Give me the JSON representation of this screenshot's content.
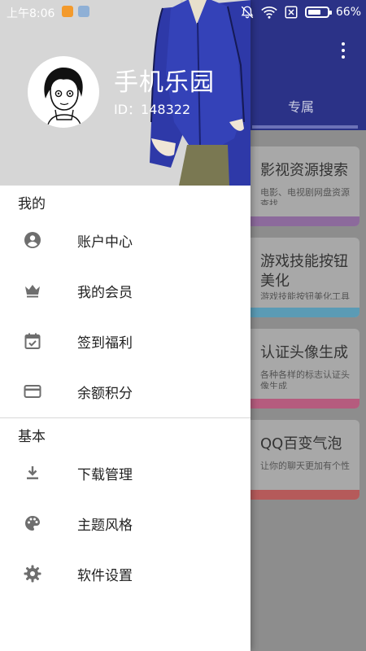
{
  "status_bar": {
    "time": "上午8:06",
    "battery": "66%",
    "battery_level": 0.66
  },
  "background": {
    "tab_label": "专属",
    "cards": [
      {
        "title": "影视资源搜索",
        "desc": "电影、电视剧网盘资源查找",
        "color": "#8c6a9c"
      },
      {
        "title": "游戏技能按钮美化",
        "desc": "游戏技能按钮美化工具",
        "color": "#5b9bb5"
      },
      {
        "title": "认证头像生成",
        "desc": "各种各样的标志认证头像生成",
        "color": "#b55c7e"
      },
      {
        "title": "QQ百变气泡",
        "desc": "让你的聊天更加有个性",
        "color": "#b55a5a"
      }
    ]
  },
  "drawer": {
    "user": {
      "name": "手机乐园",
      "id_text": "ID：148322"
    },
    "section_mine": "我的",
    "section_basic": "基本",
    "items": [
      {
        "label": "账户中心",
        "icon": "account-circle-icon"
      },
      {
        "label": "我的会员",
        "icon": "crown-icon"
      },
      {
        "label": "签到福利",
        "icon": "calendar-check-icon"
      },
      {
        "label": "余额积分",
        "icon": "credit-card-icon"
      },
      {
        "label": "下载管理",
        "icon": "download-icon"
      },
      {
        "label": "主题风格",
        "icon": "palette-icon"
      },
      {
        "label": "软件设置",
        "icon": "settings-icon"
      }
    ]
  }
}
